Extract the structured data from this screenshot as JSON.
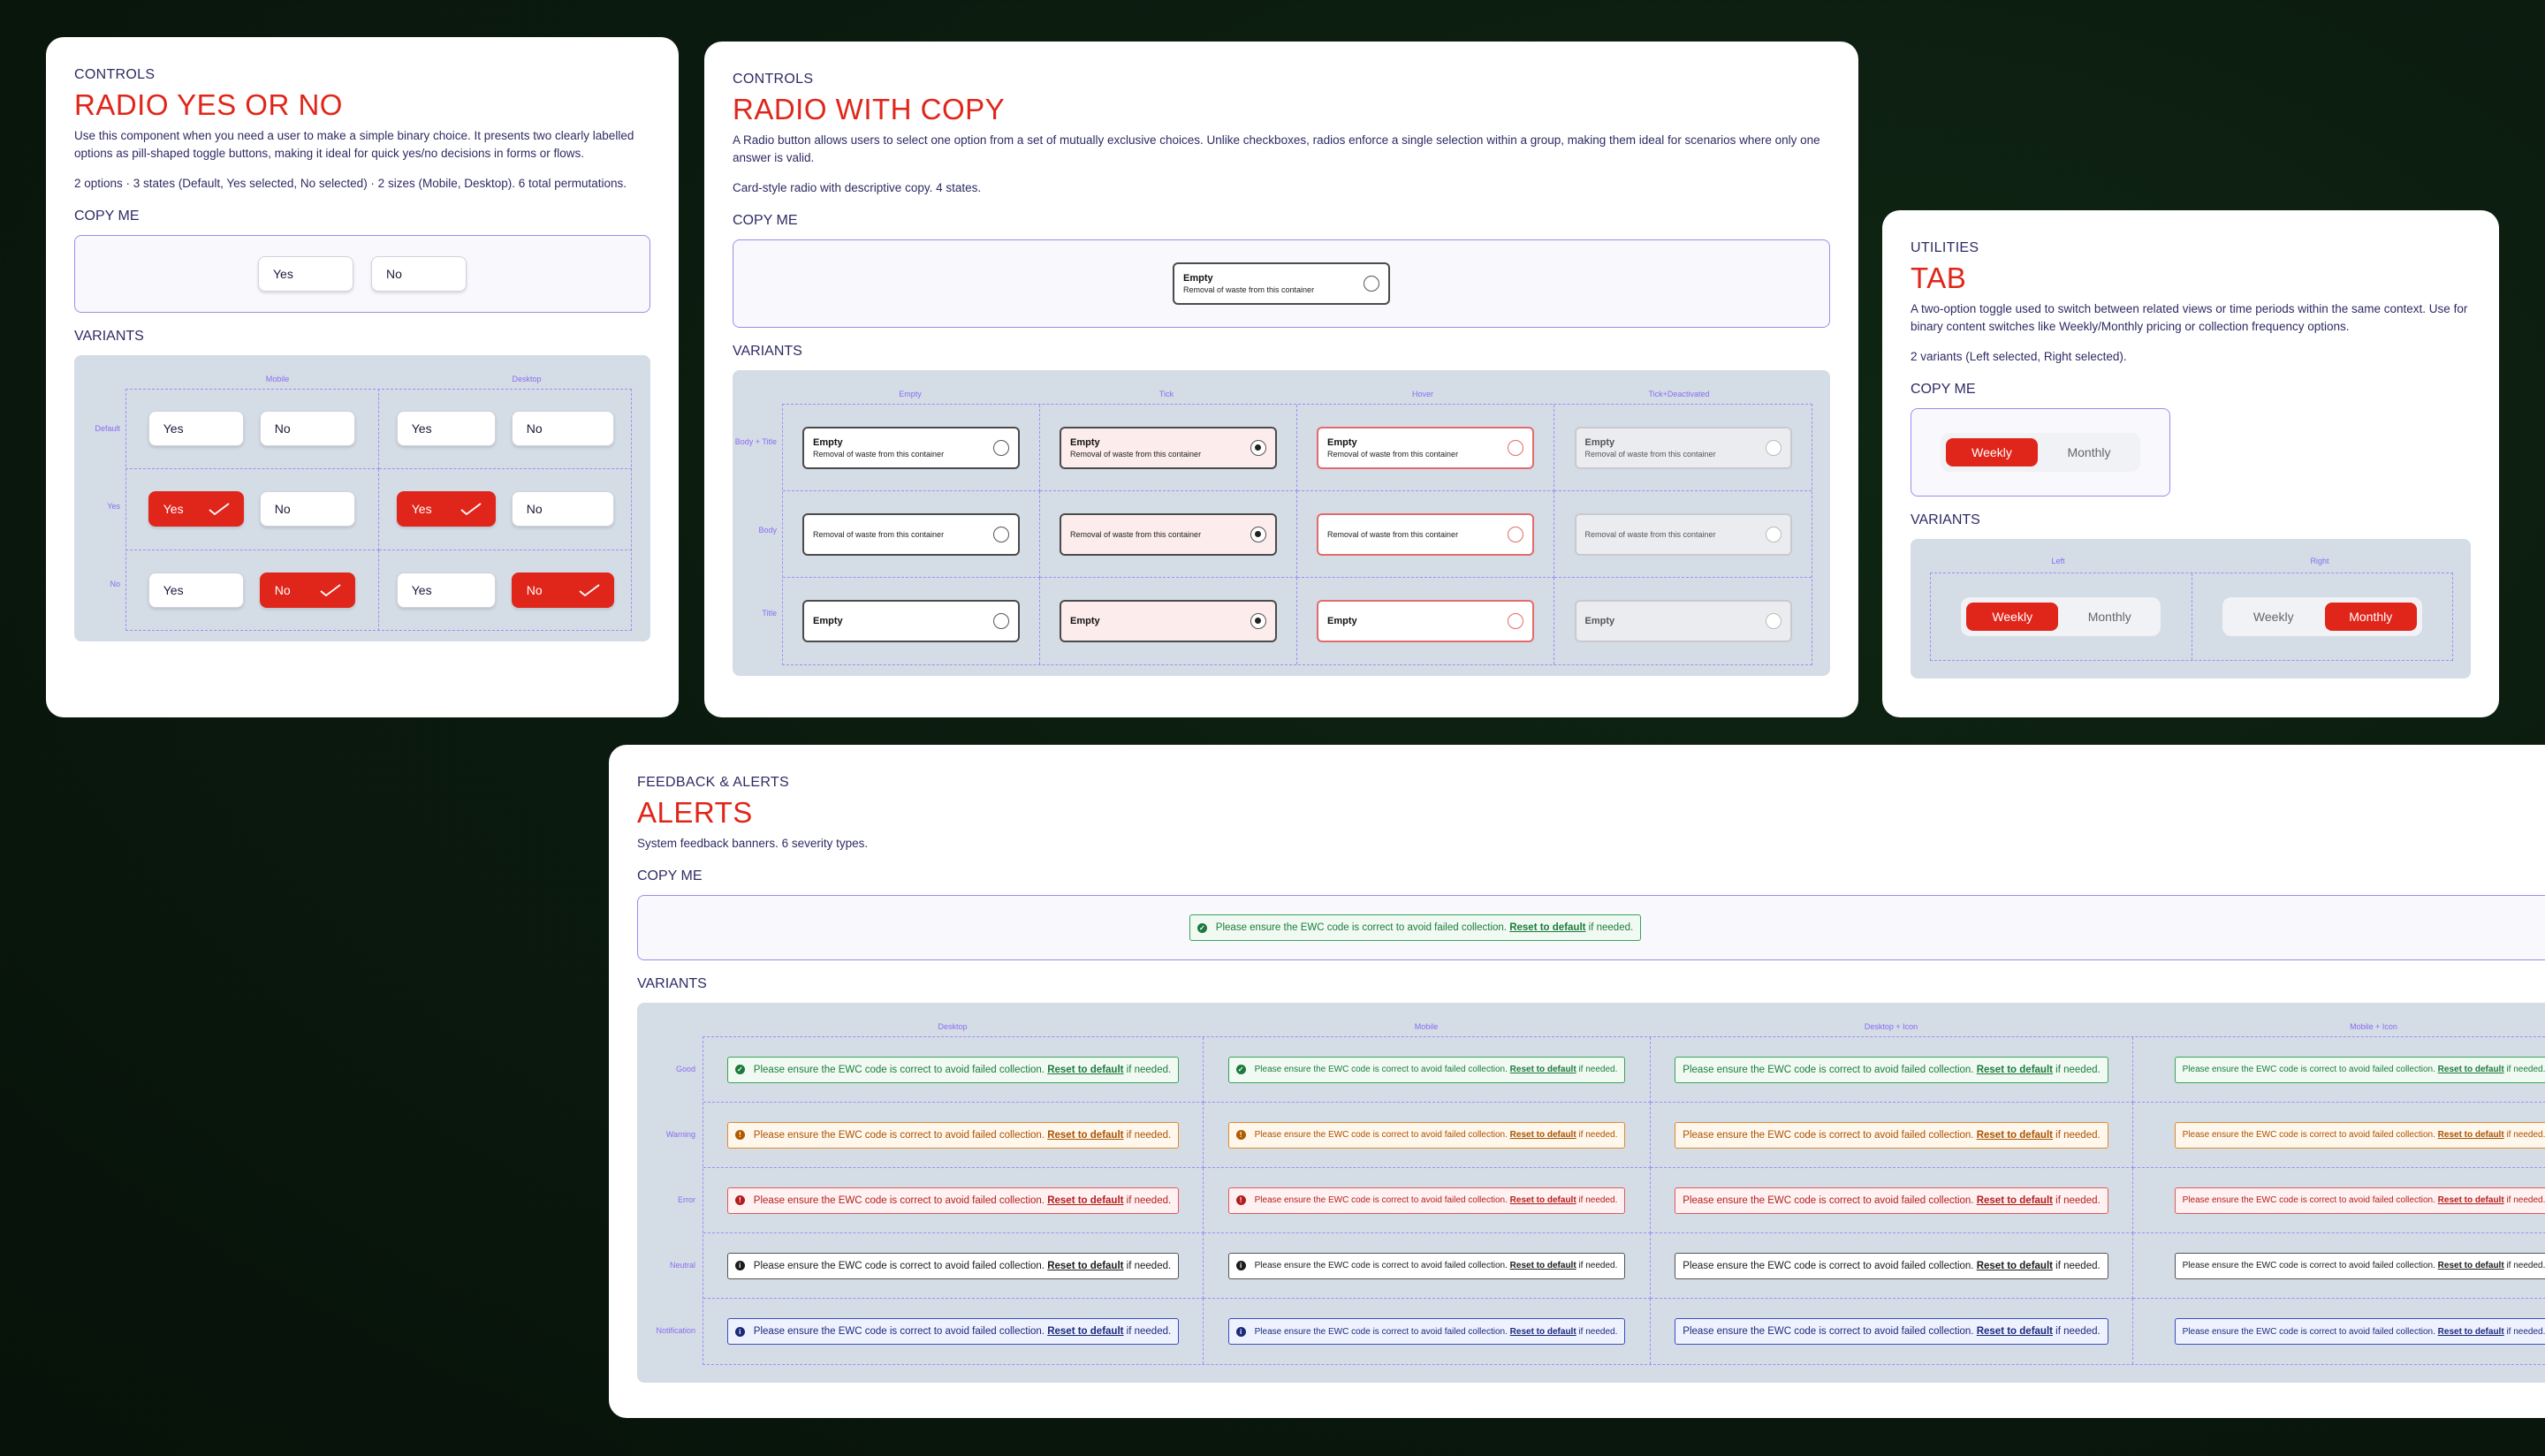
{
  "colors": {
    "accent": "#e0261a",
    "dash": "#a38ef5",
    "varbg": "#d4dce6"
  },
  "radio_yes_no": {
    "category": "CONTROLS",
    "title": "RADIO YES OR NO",
    "description": "Use this component when you need a user to make a simple binary choice. It presents two clearly labelled options as pill-shaped toggle buttons, making it ideal for quick yes/no decisions in forms or flows.",
    "meta": "2 options · 3 states (Default, Yes selected, No selected) · 2 sizes (Mobile, Desktop). 6 total permutations.",
    "copy_me": "COPY ME",
    "variants": "VARIANTS",
    "yes": "Yes",
    "no": "No",
    "cols": [
      "Mobile",
      "Desktop"
    ],
    "rows": [
      "Default",
      "Yes",
      "No"
    ]
  },
  "radio_copy": {
    "category": "CONTROLS",
    "title": "RADIO WITH COPY",
    "description": "A Radio button allows users to select one option from a set of mutually exclusive choices. Unlike checkboxes, radios enforce a single selection within a group, making them ideal for scenarios where only one answer is valid.",
    "meta": "Card-style radio with descriptive copy. 4 states.",
    "copy_me": "COPY ME",
    "variants": "VARIANTS",
    "card_title": "Empty",
    "card_body": "Removal of waste from this container",
    "cols": [
      "Empty",
      "Tick",
      "Hover",
      "Tick+Deactivated"
    ],
    "rows": [
      "Body + Title",
      "Body",
      "Title"
    ]
  },
  "tab": {
    "category": "UTILITIES",
    "title": "TAB",
    "description": "A two-option toggle used to switch between related views or time periods within the same context. Use for binary content switches like Weekly/Monthly pricing or collection frequency options.",
    "meta": "2 variants (Left selected, Right selected).",
    "copy_me": "COPY ME",
    "variants": "VARIANTS",
    "left": "Weekly",
    "right": "Monthly",
    "cols": [
      "Left",
      "Right"
    ]
  },
  "alerts": {
    "category": "FEEDBACK & ALERTS",
    "title": "ALERTS",
    "description": "System feedback banners. 6 severity types.",
    "copy_me": "COPY ME",
    "variants": "VARIANTS",
    "msg_pre": "Please ensure the EWC code is correct to avoid failed collection.",
    "msg_link": "Reset to default",
    "msg_post": "if needed.",
    "cols": [
      "Desktop",
      "Mobile",
      "Desktop + Icon",
      "Mobile + Icon"
    ],
    "rows": [
      "Good",
      "Warning",
      "Error",
      "Neutral",
      "Notification"
    ]
  }
}
